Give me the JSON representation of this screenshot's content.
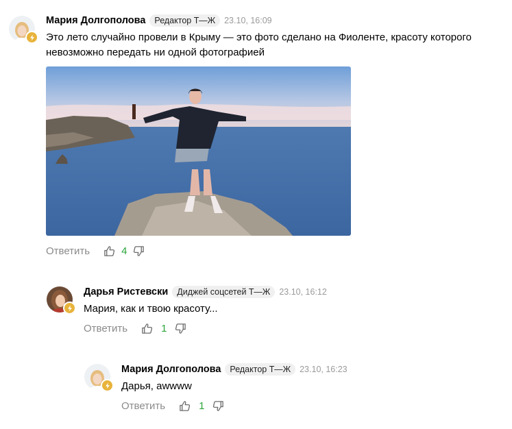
{
  "comments": [
    {
      "author": "Мария Долгополова",
      "role": "Редактор Т—Ж",
      "time": "23.10, 16:09",
      "text": "Это лето случайно провели в Крыму — это фото сделано на Фиоленте, красоту которого невозможно передать ни одной фотографией",
      "reply_label": "Ответить",
      "score": "4"
    },
    {
      "author": "Дарья Ристевски",
      "role": "Диджей соцсетей Т—Ж",
      "time": "23.10, 16:12",
      "text": "Мария, как и твою красоту...",
      "reply_label": "Ответить",
      "score": "1"
    },
    {
      "author": "Мария Долгополова",
      "role": "Редактор Т—Ж",
      "time": "23.10, 16:23",
      "text": "Дарья, awwww",
      "reply_label": "Ответить",
      "score": "1"
    }
  ],
  "colors": {
    "score_positive": "#2aa43a",
    "muted": "#8a8a8a",
    "badge": "#e8b33a",
    "role_bg": "#f0f0f0"
  },
  "icons": [
    "thumbs-up-icon",
    "thumbs-down-icon",
    "lightning-badge-icon"
  ]
}
